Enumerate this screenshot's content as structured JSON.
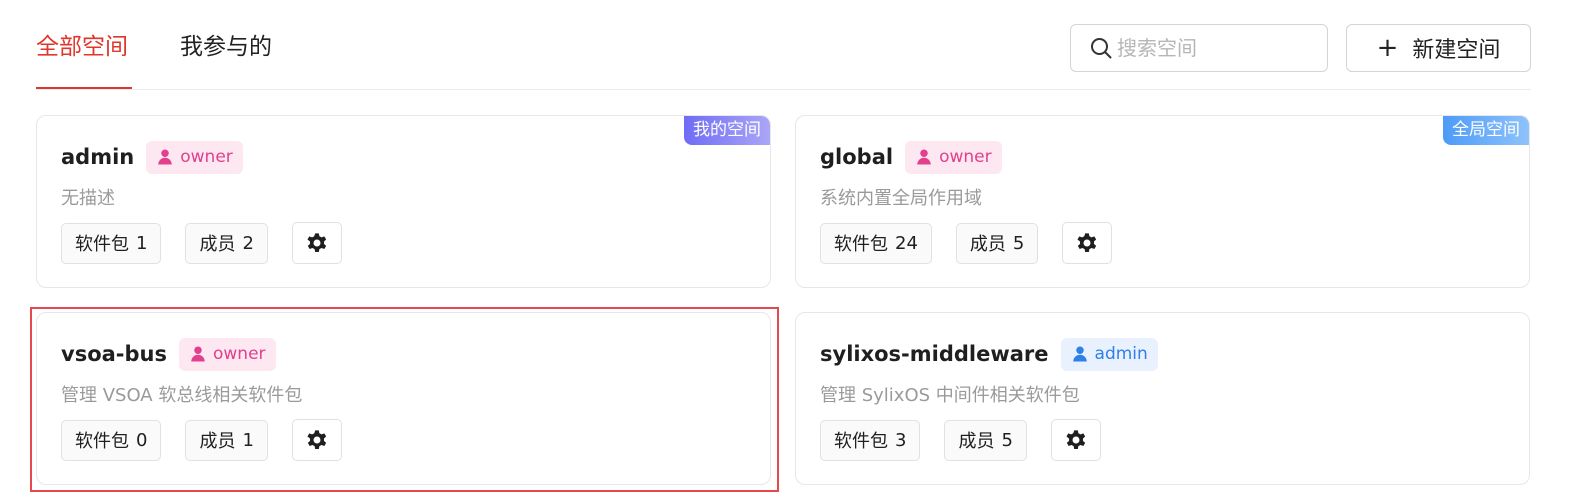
{
  "tabs": [
    {
      "label": "全部空间",
      "active": true
    },
    {
      "label": "我参与的",
      "active": false
    }
  ],
  "search": {
    "placeholder": "搜索空间",
    "icon": "search-icon"
  },
  "new_space_button": {
    "icon": "plus",
    "label": "新建空间"
  },
  "colors": {
    "accent_red": "#e0362c",
    "owner_pink": "#e23f8d",
    "admin_blue": "#2f80e8",
    "badge_mine": "#6f6cf6",
    "badge_global": "#4d9bf8"
  },
  "cards": [
    {
      "name": "admin",
      "role": "owner",
      "badge": "我的空间",
      "description": "无描述",
      "packages": {
        "label": "软件包",
        "count": "1"
      },
      "members": {
        "label": "成员",
        "count": "2"
      },
      "selected": false
    },
    {
      "name": "global",
      "role": "owner",
      "badge": "全局空间",
      "description": "系统内置全局作用域",
      "packages": {
        "label": "软件包",
        "count": "24"
      },
      "members": {
        "label": "成员",
        "count": "5"
      },
      "selected": false
    },
    {
      "name": "vsoa-bus",
      "role": "owner",
      "badge": "",
      "description": "管理 VSOA 软总线相关软件包",
      "packages": {
        "label": "软件包",
        "count": "0"
      },
      "members": {
        "label": "成员",
        "count": "1"
      },
      "selected": true
    },
    {
      "name": "sylixos-middleware",
      "role": "admin",
      "badge": "",
      "description": "管理 SylixOS 中间件相关软件包",
      "packages": {
        "label": "软件包",
        "count": "3"
      },
      "members": {
        "label": "成员",
        "count": "5"
      },
      "selected": false
    }
  ]
}
